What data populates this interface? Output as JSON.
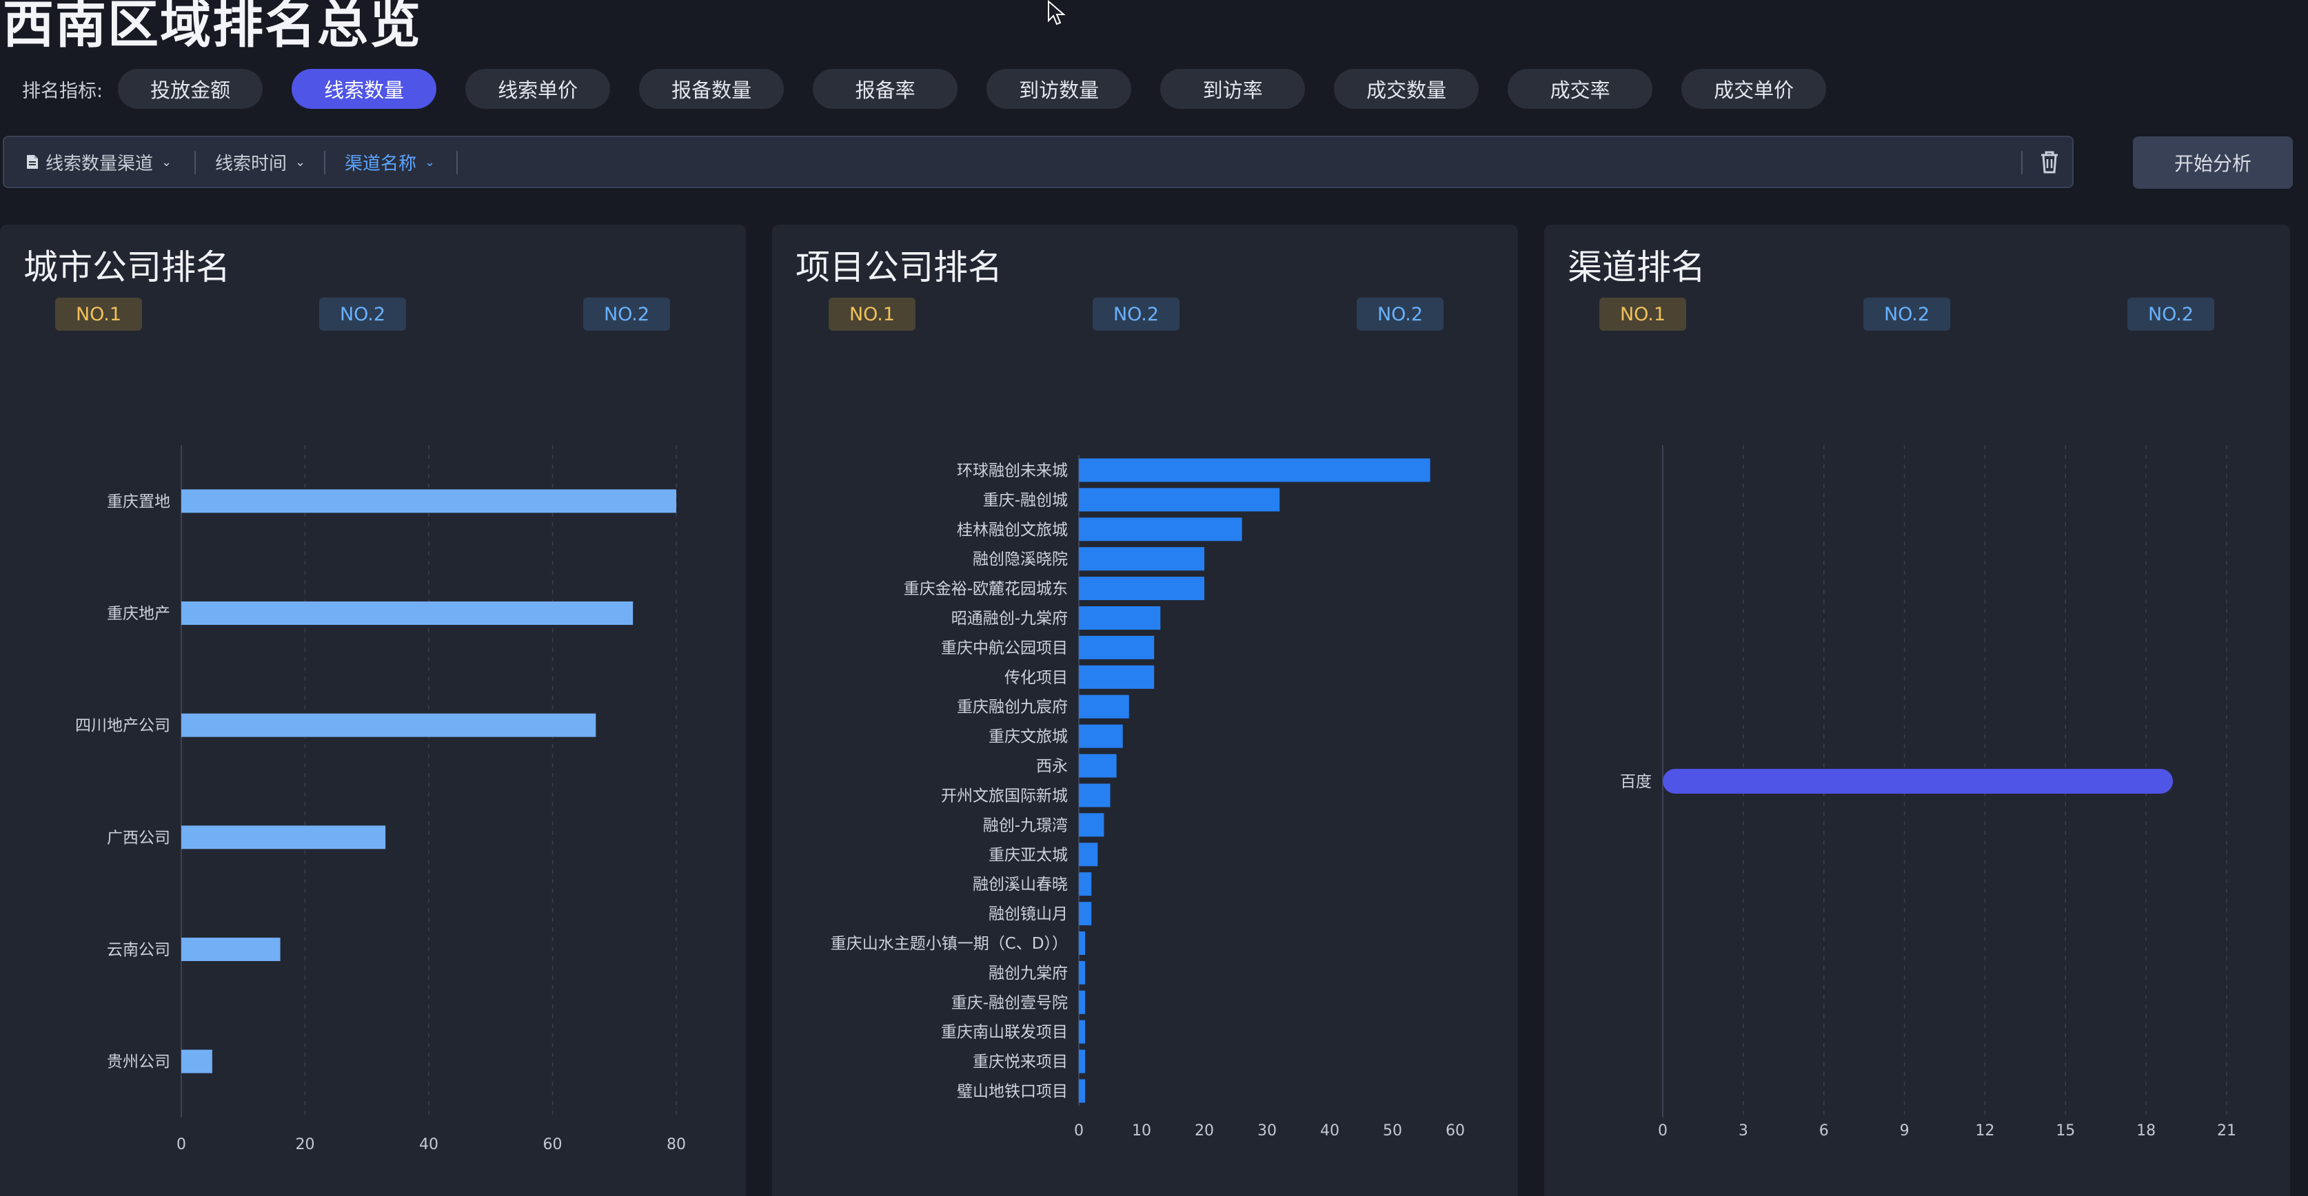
{
  "page": {
    "title": "西南区域排名总览"
  },
  "metrics": {
    "label": "排名指标:",
    "items": [
      "投放金额",
      "线索数量",
      "线索单价",
      "报备数量",
      "报备率",
      "到访数量",
      "到访率",
      "成交数量",
      "成交率",
      "成交单价"
    ],
    "active_index": 1
  },
  "filters": {
    "channel_label": "线索数量渠道",
    "time_label": "线索时间",
    "name_label": "渠道名称",
    "analyze_label": "开始分析"
  },
  "colors": {
    "accent": "#4f55e6",
    "city_bar": "#72aff5",
    "project_bar": "#2680f2",
    "channel_bar": "#4f55e6",
    "gold": "#f1c15b",
    "blue_badge": "#69b1ff"
  },
  "icons": [
    "document-icon",
    "chevron-down-icon",
    "trash-icon",
    "cursor-icon"
  ],
  "panels": [
    {
      "title": "城市公司排名",
      "badges": [
        "NO.1",
        "NO.2",
        "NO.2"
      ]
    },
    {
      "title": "项目公司排名",
      "badges": [
        "NO.1",
        "NO.2",
        "NO.2"
      ]
    },
    {
      "title": "渠道排名",
      "badges": [
        "NO.1",
        "NO.2",
        "NO.2"
      ]
    }
  ],
  "chart_data": [
    {
      "type": "bar",
      "orientation": "horizontal",
      "title": "城市公司排名",
      "categories": [
        "重庆置地",
        "重庆地产",
        "四川地产公司",
        "广西公司",
        "云南公司",
        "贵州公司"
      ],
      "values": [
        80,
        73,
        67,
        33,
        16,
        5
      ],
      "xlim": [
        0,
        80
      ],
      "xticks": [
        0,
        20,
        40,
        60,
        80
      ],
      "grid": true
    },
    {
      "type": "bar",
      "orientation": "horizontal",
      "title": "项目公司排名",
      "categories": [
        "环球融创未来城",
        "重庆-融创城",
        "桂林融创文旅城",
        "融创隐溪晓院",
        "重庆金裕-欧麓花园城东",
        "昭通融创-九棠府",
        "重庆中航公园项目",
        "传化项目",
        "重庆融创九宸府",
        "重庆文旅城",
        "西永",
        "开州文旅国际新城",
        "融创-九璟湾",
        "重庆亚太城",
        "融创溪山春晓",
        "融创镜山月",
        "重庆山水主题小镇一期（C、D））",
        "融创九棠府",
        "重庆-融创壹号院",
        "重庆南山联发项目",
        "重庆悦来项目",
        "璧山地铁口项目"
      ],
      "values": [
        56,
        32,
        26,
        20,
        20,
        13,
        12,
        12,
        8,
        7,
        6,
        5,
        4,
        3,
        2,
        2,
        1,
        1,
        1,
        1,
        1,
        1
      ],
      "xlim": [
        0,
        60
      ],
      "xticks": [
        0,
        10,
        20,
        30,
        40,
        50,
        60
      ],
      "grid": false
    },
    {
      "type": "bar",
      "orientation": "horizontal",
      "title": "渠道排名",
      "categories": [
        "百度"
      ],
      "values": [
        19
      ],
      "xlim": [
        0,
        21
      ],
      "xticks": [
        0,
        3,
        6,
        9,
        12,
        15,
        18,
        21
      ],
      "grid": true
    }
  ]
}
